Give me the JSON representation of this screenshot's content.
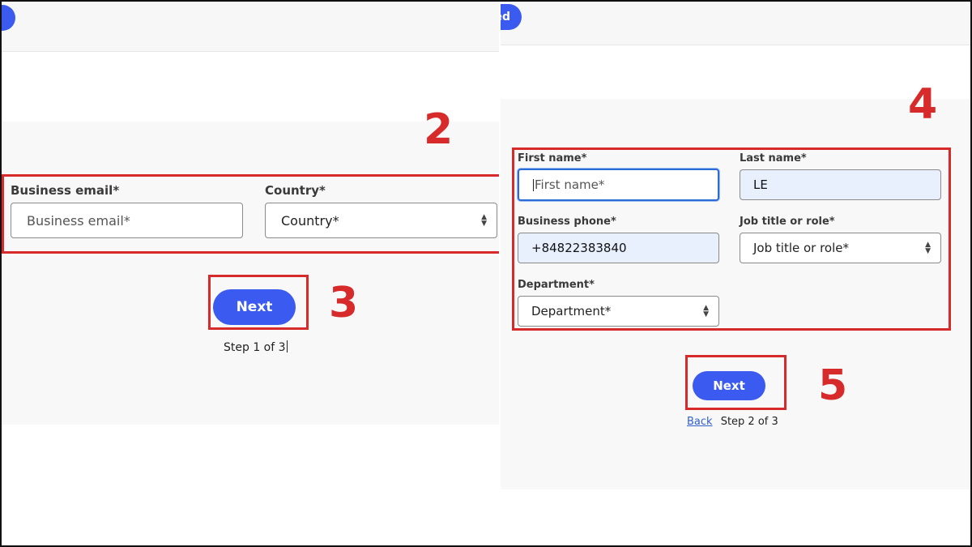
{
  "left": {
    "top_pill_text": "",
    "fields": {
      "email_label": "Business email*",
      "email_placeholder": "Business email*",
      "country_label": "Country*",
      "country_value": "Country*"
    },
    "next_label": "Next",
    "step_text": "Step 1 of 3"
  },
  "right": {
    "top_pill_text": "ed",
    "fields": {
      "first_name_label": "First name*",
      "first_name_placeholder": "First name*",
      "last_name_label": "Last name*",
      "last_name_value": "LE",
      "phone_label": "Business phone*",
      "phone_value": "+84822383840",
      "job_label": "Job title or role*",
      "job_value": "Job title or role*",
      "department_label": "Department*",
      "department_value": "Department*"
    },
    "next_label": "Next",
    "back_label": "Back",
    "step_text": "Step 2 of 3"
  },
  "annotations": [
    "2",
    "3",
    "4",
    "5"
  ],
  "colors": {
    "accent": "#3b5bf0",
    "highlight": "#d72a2a",
    "autofill": "#e8f0fe",
    "focus": "#2b6bd6"
  }
}
